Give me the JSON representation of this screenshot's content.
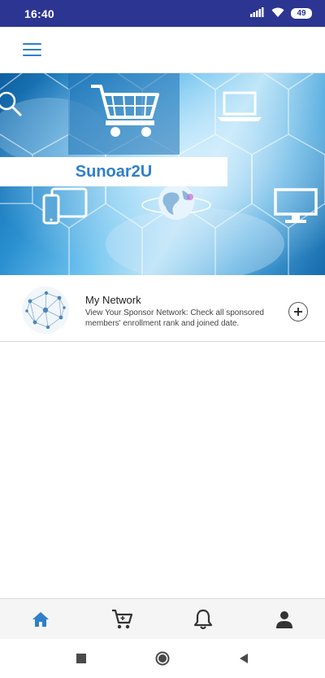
{
  "status_bar": {
    "time": "16:40",
    "battery": "49",
    "icons": [
      "signal-icon",
      "wifi-icon",
      "battery-icon"
    ]
  },
  "app_bar": {
    "menu_icon": "hamburger-menu-icon"
  },
  "banner": {
    "title": "Sunoar2U",
    "icons": [
      "search-icon",
      "shopping-cart-icon",
      "laptop-icon",
      "tablet-phone-icon",
      "globe-icon",
      "monitor-icon"
    ]
  },
  "list": {
    "items": [
      {
        "title": "My Network",
        "description": "View Your Sponsor Network: Check all sponsored members' enrollment rank and joined date.",
        "thumbnail": "network-graph-icon",
        "action_icon": "plus-circle-icon"
      }
    ]
  },
  "bottom_nav": {
    "items": [
      "home-icon",
      "cart-icon",
      "bell-icon",
      "profile-icon"
    ],
    "active_index": 0,
    "active_color": "#2f7fc9",
    "inactive_color": "#333333"
  },
  "system_nav": {
    "items": [
      "recents-icon",
      "home-circle-icon",
      "back-icon"
    ]
  },
  "colors": {
    "status_bar": "#2c3591",
    "accent": "#2f7fc9"
  }
}
